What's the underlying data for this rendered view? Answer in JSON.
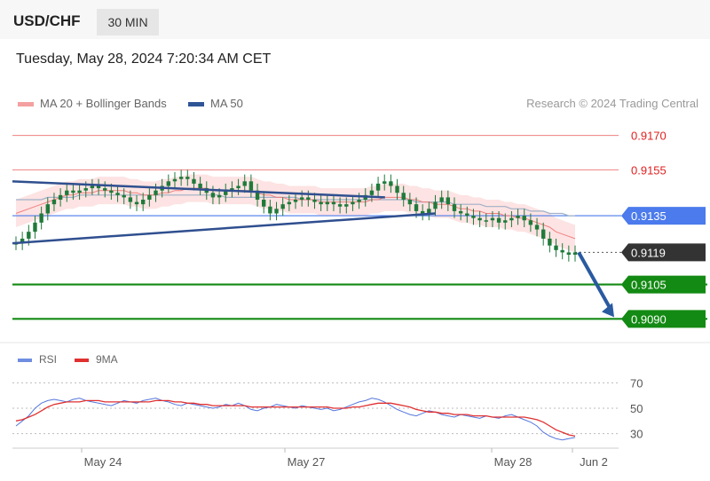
{
  "header": {
    "pair": "USD/CHF",
    "timeframe": "30 MIN",
    "datetime": "Tuesday, May 28, 2024 7:20:34 AM CET"
  },
  "legend": {
    "ma20": "MA 20 + Bollinger Bands",
    "ma50": "MA 50",
    "credit": "Research © 2024 Trading Central",
    "rsi": "RSI",
    "rsi_ma": "9MA"
  },
  "colors": {
    "ma20": "#f08080",
    "band_fill": "#fde3e3",
    "ma50": "#9fb0c8",
    "candle": "#1f7a3a",
    "trendline": "#2f4f8f",
    "pivot_line": "#4b7bec",
    "support": "#138a13",
    "resistance": "#f08080",
    "current": "#333333",
    "arrow": "#2a5aa0",
    "rsi": "#5577dd",
    "rsi_ma": "#e03030"
  },
  "chart_data": [
    {
      "type": "line",
      "title": "",
      "x_ticks": [
        "May 24",
        "May 27",
        "May 28",
        "Jun 2"
      ],
      "ylim": [
        0.9082,
        0.9178
      ],
      "levels": [
        {
          "value": 0.917,
          "label": "0.9170",
          "kind": "resistance"
        },
        {
          "value": 0.9155,
          "label": "0.9155",
          "kind": "resistance"
        },
        {
          "value": 0.9135,
          "label": "0.9135",
          "kind": "pivot"
        },
        {
          "value": 0.9119,
          "label": "0.9119",
          "kind": "current"
        },
        {
          "value": 0.9105,
          "label": "0.9105",
          "kind": "support"
        },
        {
          "value": 0.909,
          "label": "0.9090",
          "kind": "support"
        }
      ],
      "close_series": [
        0.9123,
        0.9125,
        0.9128,
        0.9132,
        0.9136,
        0.914,
        0.9142,
        0.9144,
        0.9146,
        0.9145,
        0.9146,
        0.9147,
        0.9148,
        0.9147,
        0.9146,
        0.9145,
        0.9144,
        0.9143,
        0.9141,
        0.914,
        0.9142,
        0.9144,
        0.9146,
        0.9148,
        0.915,
        0.9151,
        0.9152,
        0.9151,
        0.9149,
        0.9147,
        0.9145,
        0.9143,
        0.9144,
        0.9146,
        0.9147,
        0.9148,
        0.915,
        0.9146,
        0.9142,
        0.9139,
        0.9136,
        0.9138,
        0.914,
        0.9141,
        0.9142,
        0.9143,
        0.9142,
        0.9141,
        0.914,
        0.9141,
        0.914,
        0.9139,
        0.914,
        0.9141,
        0.9142,
        0.9144,
        0.9146,
        0.9149,
        0.915,
        0.9148,
        0.9145,
        0.9142,
        0.914,
        0.9137,
        0.9136,
        0.9138,
        0.9141,
        0.9143,
        0.914,
        0.9137,
        0.9136,
        0.9135,
        0.9134,
        0.9133,
        0.9133,
        0.9134,
        0.9132,
        0.9133,
        0.9134,
        0.9135,
        0.9133,
        0.9131,
        0.9129,
        0.9125,
        0.9122,
        0.912,
        0.9119,
        0.9118,
        0.9119
      ],
      "ma20": [
        0.9136,
        0.9137,
        0.9138,
        0.9139,
        0.914,
        0.9141,
        0.9142,
        0.9143,
        0.9144,
        0.9144,
        0.9145,
        0.9145,
        0.9145,
        0.9146,
        0.9146,
        0.9146,
        0.9146,
        0.9146,
        0.9145,
        0.9145,
        0.9144,
        0.9144,
        0.9144,
        0.9145,
        0.9145,
        0.9146,
        0.9146,
        0.9147,
        0.9147,
        0.9147,
        0.9147,
        0.9146,
        0.9146,
        0.9146,
        0.9146,
        0.9146,
        0.9146,
        0.9146,
        0.9145,
        0.9144,
        0.9144,
        0.9143,
        0.9143,
        0.9142,
        0.9142,
        0.9142,
        0.9142,
        0.9142,
        0.9141,
        0.9141,
        0.9141,
        0.9141,
        0.9141,
        0.9141,
        0.9141,
        0.9141,
        0.9142,
        0.9142,
        0.9143,
        0.9143,
        0.9143,
        0.9143,
        0.9142,
        0.9142,
        0.9141,
        0.9141,
        0.914,
        0.914,
        0.914,
        0.9139,
        0.9138,
        0.9138,
        0.9137,
        0.9137,
        0.9136,
        0.9136,
        0.9136,
        0.9135,
        0.9135,
        0.9134,
        0.9134,
        0.9133,
        0.9132,
        0.9131,
        0.913,
        0.9128,
        0.9127,
        0.9126,
        0.9125
      ],
      "band_width": 0.0006,
      "ma50": [
        0.9142,
        0.9142,
        0.9142,
        0.9142,
        0.9142,
        0.9143,
        0.9143,
        0.9143,
        0.9143,
        0.9143,
        0.9144,
        0.9144,
        0.9144,
        0.9144,
        0.9144,
        0.9144,
        0.9144,
        0.9144,
        0.9144,
        0.9144,
        0.9144,
        0.9144,
        0.9144,
        0.9144,
        0.9144,
        0.9144,
        0.9144,
        0.9144,
        0.9144,
        0.9144,
        0.9144,
        0.9144,
        0.9144,
        0.9143,
        0.9143,
        0.9143,
        0.9143,
        0.9143,
        0.9143,
        0.9143,
        0.9143,
        0.9143,
        0.9143,
        0.9143,
        0.9143,
        0.9142,
        0.9142,
        0.9142,
        0.9142,
        0.9142,
        0.9142,
        0.9142,
        0.9142,
        0.9142,
        0.9142,
        0.9142,
        0.9142,
        0.9142,
        0.9142,
        0.9142,
        0.9142,
        0.9142,
        0.9142,
        0.9141,
        0.9141,
        0.9141,
        0.9141,
        0.9141,
        0.9141,
        0.914,
        0.914,
        0.914,
        0.914,
        0.914,
        0.9139,
        0.9139,
        0.9139,
        0.9139,
        0.9138,
        0.9138,
        0.9138,
        0.9137,
        0.9137,
        0.9137,
        0.9136,
        0.9136,
        0.9136,
        0.9135,
        0.9135
      ],
      "trendlines": [
        {
          "from": [
            0,
            0.915
          ],
          "to": [
            0.66,
            0.9143
          ]
        },
        {
          "from": [
            0,
            0.9123
          ],
          "to": [
            0.75,
            0.9136
          ]
        }
      ],
      "forecast_arrow": {
        "from": 0.9119,
        "to": 0.909
      }
    },
    {
      "type": "line",
      "title": "",
      "ylim": [
        22,
        78
      ],
      "y_ticks": [
        30,
        50,
        70
      ],
      "series": [
        {
          "name": "RSI",
          "values": [
            36,
            40,
            44,
            50,
            54,
            56,
            57,
            56,
            55,
            57,
            58,
            56,
            55,
            54,
            53,
            52,
            54,
            56,
            55,
            54,
            56,
            57,
            58,
            56,
            55,
            53,
            52,
            54,
            53,
            52,
            51,
            50,
            51,
            53,
            52,
            54,
            52,
            49,
            48,
            50,
            51,
            53,
            52,
            51,
            50,
            52,
            51,
            50,
            49,
            50,
            48,
            49,
            51,
            53,
            55,
            56,
            58,
            57,
            55,
            52,
            49,
            47,
            45,
            44,
            46,
            48,
            47,
            45,
            44,
            43,
            45,
            44,
            43,
            42,
            44,
            43,
            42,
            44,
            45,
            43,
            41,
            39,
            36,
            31,
            28,
            26,
            25,
            26,
            27
          ]
        },
        {
          "name": "9MA",
          "values": [
            40,
            41,
            43,
            45,
            48,
            51,
            53,
            54,
            55,
            55,
            55,
            56,
            56,
            56,
            55,
            55,
            55,
            55,
            55,
            55,
            55,
            55,
            56,
            56,
            56,
            55,
            55,
            54,
            54,
            53,
            53,
            52,
            52,
            52,
            52,
            52,
            52,
            51,
            51,
            51,
            51,
            51,
            51,
            51,
            51,
            51,
            51,
            51,
            51,
            51,
            50,
            50,
            50,
            51,
            51,
            52,
            53,
            54,
            54,
            54,
            53,
            52,
            51,
            49,
            48,
            47,
            47,
            46,
            46,
            45,
            45,
            45,
            44,
            44,
            44,
            43,
            43,
            43,
            43,
            43,
            43,
            42,
            41,
            39,
            36,
            33,
            31,
            29,
            28
          ]
        }
      ]
    }
  ]
}
